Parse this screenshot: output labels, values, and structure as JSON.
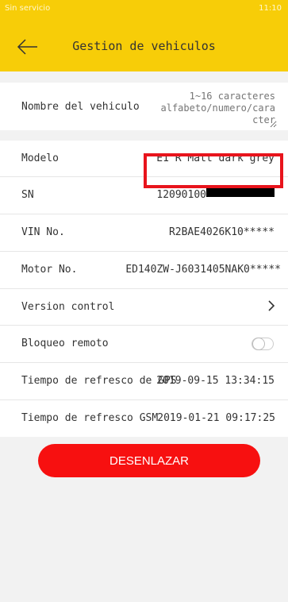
{
  "status_bar": {
    "left_text": "Sin servicio",
    "right_text": "11:10"
  },
  "header": {
    "title": "Gestion de vehiculos",
    "back_icon": "arrow-left-icon"
  },
  "name_field": {
    "label": "Nombre del vehiculo",
    "placeholder": "1~16 caracteres alfabeto/numero/caracter"
  },
  "details": {
    "model_label": "Modelo",
    "model_value": "E1 R Matt dark grey",
    "sn_label": "SN",
    "sn_value": "12090100",
    "vin_label": "VIN No.",
    "vin_value": "R2BAE4026K10*****",
    "motor_label": "Motor No.",
    "motor_value": "ED140ZW-J6031405NAK0*****",
    "version_label": "Version control",
    "lock_label": "Bloqueo remoto",
    "lock_enabled": false,
    "gps_label": "Tiempo de refresco de GPS",
    "gps_value": "2019-09-15 13:34:15",
    "gsm_label": "Tiempo de refresco GSM",
    "gsm_value": "2019-01-21 09:17:25"
  },
  "actions": {
    "unlink_label": "DESENLAZAR"
  },
  "colors": {
    "header": "#f7cd08",
    "unlink_button": "#f71010",
    "highlight_box": "#e8141c"
  }
}
